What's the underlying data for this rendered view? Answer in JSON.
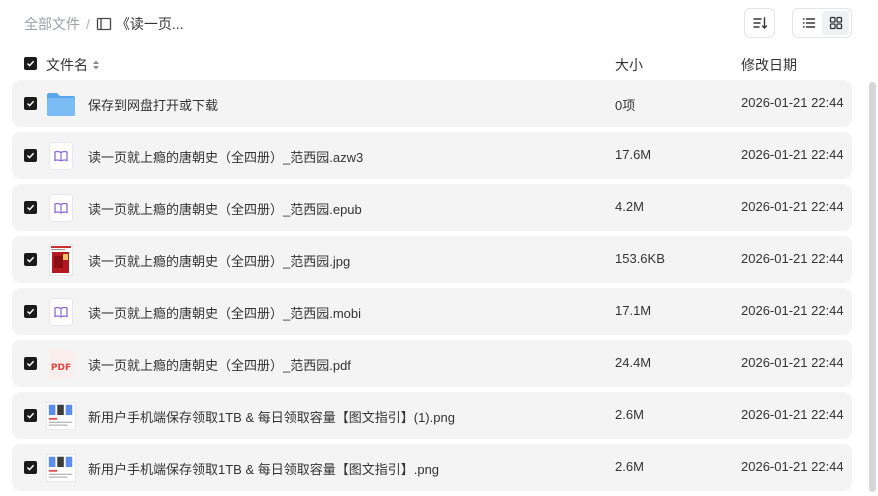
{
  "breadcrumb": {
    "root": "全部文件",
    "separator": "/",
    "current": "《读一页..."
  },
  "header": {
    "name": "文件名",
    "size": "大小",
    "date": "修改日期"
  },
  "files": [
    {
      "icon": "folder-icon",
      "name": "保存到网盘打开或下载",
      "size": "0项",
      "date": "2026-01-21 22:44"
    },
    {
      "icon": "ebook-icon",
      "name": "读一页就上瘾的唐朝史（全四册）_范西园.azw3",
      "size": "17.6M",
      "date": "2026-01-21 22:44"
    },
    {
      "icon": "ebook-icon",
      "name": "读一页就上瘾的唐朝史（全四册）_范西园.epub",
      "size": "4.2M",
      "date": "2026-01-21 22:44"
    },
    {
      "icon": "image-thumbnail-icon",
      "name": "读一页就上瘾的唐朝史（全四册）_范西园.jpg",
      "size": "153.6KB",
      "date": "2026-01-21 22:44"
    },
    {
      "icon": "ebook-icon",
      "name": "读一页就上瘾的唐朝史（全四册）_范西园.mobi",
      "size": "17.1M",
      "date": "2026-01-21 22:44"
    },
    {
      "icon": "pdf-icon",
      "name": "读一页就上瘾的唐朝史（全四册）_范西园.pdf",
      "size": "24.4M",
      "date": "2026-01-21 22:44"
    },
    {
      "icon": "screenshot-thumbnail-icon",
      "name": "新用户手机端保存领取1TB & 每日领取容量【图文指引】(1).png",
      "size": "2.6M",
      "date": "2026-01-21 22:44"
    },
    {
      "icon": "screenshot-thumbnail-icon",
      "name": "新用户手机端保存领取1TB & 每日领取容量【图文指引】.png",
      "size": "2.6M",
      "date": "2026-01-21 22:44"
    }
  ],
  "icons": {
    "pdf_label": "PDF"
  },
  "colors": {
    "row_bg": "#f4f4f5",
    "checkbox": "#1b1b1b",
    "folder": "#6fb3f2",
    "ebook_accent": "#8b6ad8",
    "pdf_red": "#e0443a"
  }
}
